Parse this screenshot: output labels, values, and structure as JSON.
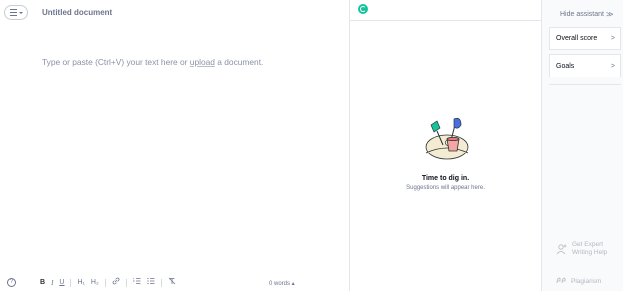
{
  "editor": {
    "title": "Untitled document",
    "placeholder_before": "Type or paste (Ctrl+V) your text here or ",
    "placeholder_link": "upload",
    "placeholder_after": " a document.",
    "help_glyph": "?",
    "word_count": "0 words ▴"
  },
  "toolbar": {
    "bold": "B",
    "italic": "I",
    "underline": "U",
    "h1": "H₁",
    "h2": "H₂",
    "link": "🔗",
    "numbered_list": "☰",
    "bulleted_list": "☰",
    "clear_format": "T̸"
  },
  "assistant": {
    "empty_title": "Time to dig in.",
    "empty_subtitle": "Suggestions will appear here.",
    "colors": {
      "brand": "#15c39a"
    }
  },
  "sidebar": {
    "hide_label": "Hide assistant",
    "hide_chevrons": ">>",
    "overall_score": "Overall score",
    "goals": "Goals",
    "arrow": ">",
    "expert_line1": "Get Expert",
    "expert_line2": "Writing Help",
    "plagiarism": "Plagiarism"
  },
  "icons": [
    "menu-icon",
    "grammarly-logo-icon",
    "help-icon",
    "chevron-right-icon",
    "expert-help-icon",
    "plagiarism-icon",
    "link-icon",
    "list-icon",
    "clear-format-icon"
  ]
}
